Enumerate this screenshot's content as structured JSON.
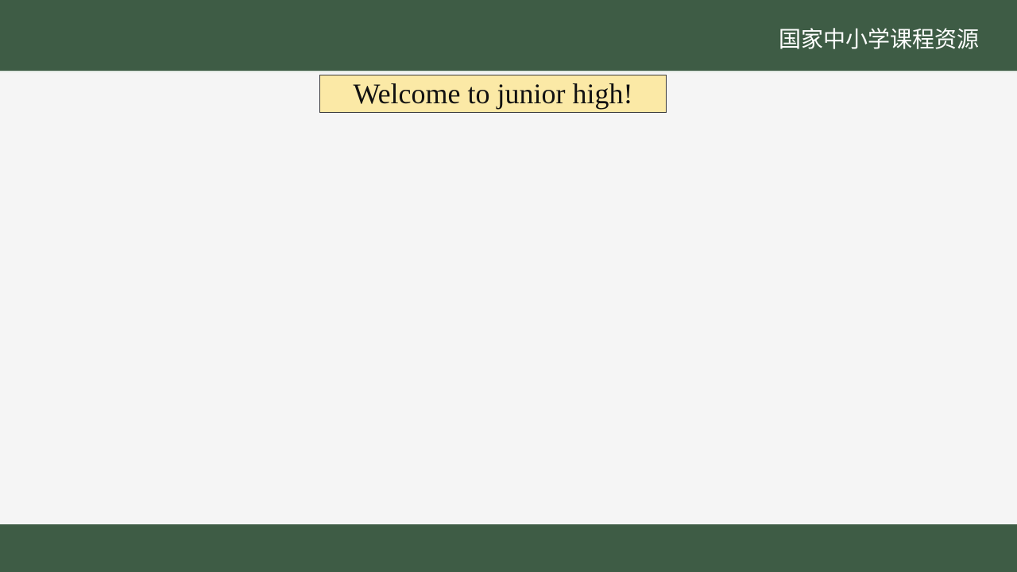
{
  "header": {
    "brand_text": "国家中小学课程资源"
  },
  "slide": {
    "title": "Welcome to junior high!"
  },
  "colors": {
    "bar_green": "#3e5c45",
    "title_box_fill": "#fbe9a6",
    "background": "#f5f5f5"
  }
}
